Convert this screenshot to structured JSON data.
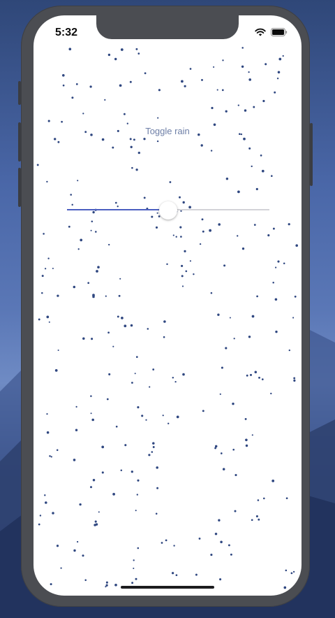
{
  "status_bar": {
    "time": "5:32",
    "icons": [
      "wifi-icon",
      "battery-icon"
    ]
  },
  "main": {
    "toggle_label": "Toggle rain"
  },
  "slider": {
    "value": 0.5
  },
  "colors": {
    "accent": "#4b5fc0",
    "drop": "#2f4780",
    "label": "#6e7fa7"
  }
}
